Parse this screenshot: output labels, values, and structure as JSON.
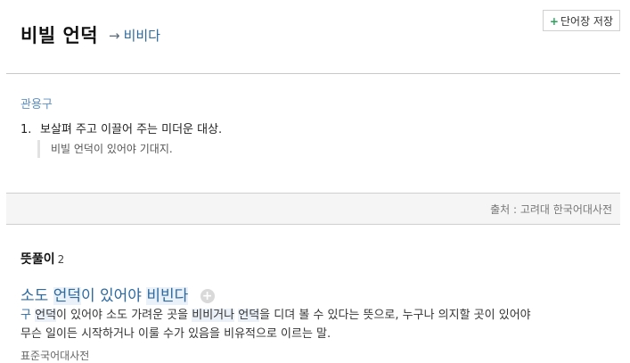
{
  "entry": {
    "headword": "비빌 언덕",
    "arrow": "→",
    "link": "비비다",
    "save_plus": "+",
    "save_label": "단어장 저장"
  },
  "sense_block": {
    "category": "관용구",
    "number": "1.",
    "definition": "보살펴 주고 이끌어 주는 미더운 대상.",
    "example": "비빌 언덕이 있어야 기대지."
  },
  "source": "출처 : 고려대 한국어대사전",
  "meanings": {
    "title": "뜻풀이",
    "count": "2",
    "phrase": {
      "part1": "소도",
      "part2": "언덕",
      "part3": "이 있어야",
      "part4": "비빈다",
      "add_icon": "+"
    },
    "definition": {
      "prefix": "구",
      "w1": "언덕",
      "t1": "이 있어야 소도 가려운 곳을",
      "w2": "비비거나",
      "w3": "언덕",
      "t2": "을 디뎌 볼 수 있다는 뜻으로, 누구나 의지할 곳이 있어야",
      "line2": "무슨 일이든 시작하거나 이룰 수가 있음을 비유적으로 이르는 말."
    },
    "dict_source": "표준국어대사전"
  }
}
